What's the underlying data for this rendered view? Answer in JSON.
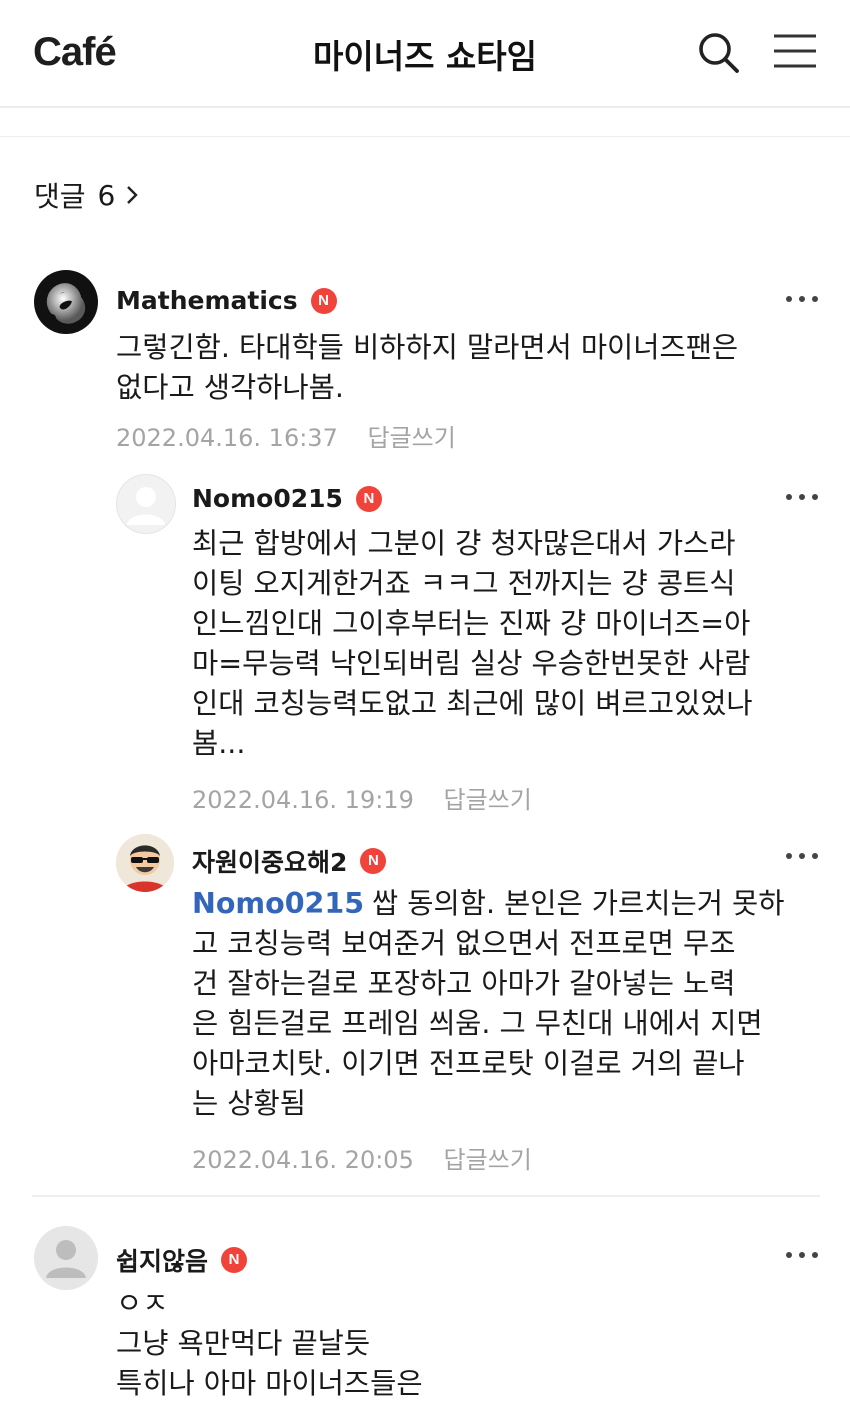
{
  "header": {
    "logo": "Café",
    "title": "마이너즈 쇼타임",
    "search_icon": "search-icon",
    "menu_icon": "hamburger-menu-icon"
  },
  "comments_header": {
    "label": "댓글",
    "count": "6"
  },
  "comments": [
    {
      "nickname": "Mathematics",
      "badge": "N",
      "lines": [
        "그렇긴함. 타대학들 비하하지 말라면서 마이너즈팬은",
        "없다고 생각하나봄."
      ],
      "date": "2022.04.16. 16:37",
      "reply": "답글쓰기"
    },
    {
      "nickname": "Nomo0215",
      "badge": "N",
      "lines": [
        "최근 합방에서 그분이 걍 청자많은대서 가스라",
        "이팅 오지게한거죠 ㅋㅋ그 전까지는 걍 콩트식",
        "인느낌인대 그이후부터는 진짜 걍 마이너즈=아",
        "마=무능력 낙인되버림 실상 우승한번못한 사람",
        "인대 코칭능력도없고 최근에 많이 벼르고있었나",
        "봄..."
      ],
      "date": "2022.04.16. 19:19",
      "reply": "답글쓰기"
    },
    {
      "nickname": "자원이중요해2",
      "badge": "N",
      "mention": "Nomo0215",
      "first_line": "쌉 동의함. 본인은 가르치는거 못하",
      "lines": [
        "고 코칭능력 보여준거 없으면서 전프로면 무조",
        "건 잘하는걸로 포장하고 아마가 갈아넣는 노력",
        "은 힘든걸로 프레임 씌움. 그 무친대 내에서 지면",
        "아마코치탓. 이기면 전프로탓 이걸로 거의 끝나",
        "는 상황됨"
      ],
      "date": "2022.04.16. 20:05",
      "reply": "답글쓰기"
    },
    {
      "nickname": "쉽지않음",
      "badge": "N",
      "lines": [
        "ㅇㅈ",
        "그냥 욕만먹다 끝날듯",
        "특히나 아마 마이너즈들은"
      ]
    }
  ]
}
